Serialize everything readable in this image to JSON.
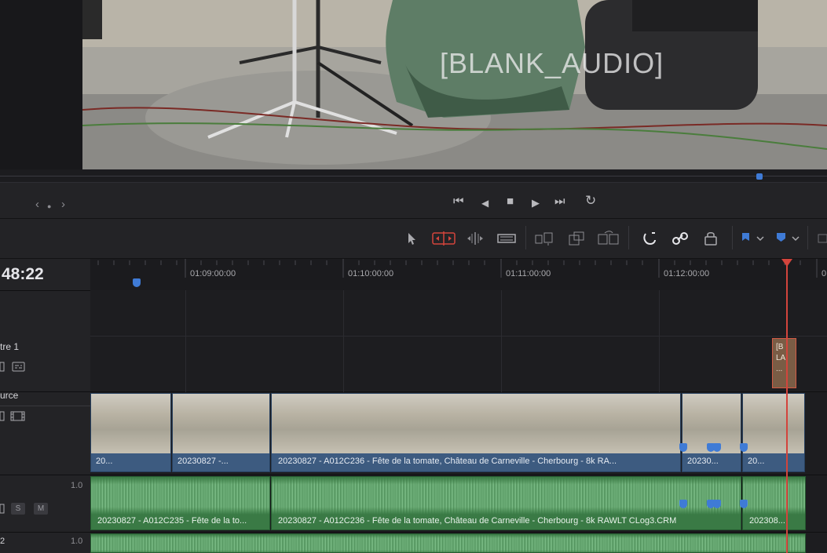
{
  "viewer": {
    "subtitle_overlay": "[BLANK_AUDIO]"
  },
  "transport": {
    "jog_left": "‹",
    "jog_dot": "●",
    "jog_right": "›",
    "first_frame": "⏮",
    "prev_frame": "◀",
    "stop": "■",
    "play": "▶",
    "last_frame": "⏭",
    "loop": "↻"
  },
  "timeline": {
    "timecode": "48:22",
    "ruler_labels": [
      "01:09:00:00",
      "01:10:00:00",
      "01:11:00:00",
      "01:12:00:00",
      "0"
    ],
    "tracks": {
      "subtitle_name": "tre 1",
      "video_name": "urce",
      "audio1_volume": "1.0",
      "audio1_solo": "S",
      "audio1_mute": "M",
      "audio2_name": "2",
      "audio2_volume": "1.0"
    },
    "subtitle_clip_text": "[B LA ...",
    "video_clips": [
      {
        "name": "20..."
      },
      {
        "name": "20230827 -..."
      },
      {
        "name": "20230827 - A012C236 - Fête de la tomate, Château de Carneville - Cherbourg - 8k RA..."
      },
      {
        "name": "20230..."
      },
      {
        "name": "20..."
      }
    ],
    "audio_clips": [
      {
        "name": "20230827 - A012C235 - Fête de la to..."
      },
      {
        "name": "20230827 - A012C236 - Fête de la tomate, Château de Carneville - Cherbourg - 8k RAWLT CLog3.CRM"
      },
      {
        "name": "202308..."
      }
    ]
  },
  "colors": {
    "playhead": "#d3443c",
    "marker": "#3f7bd6",
    "video_clip": "#3d5b80",
    "audio_clip": "#3a7a45",
    "active_tool": "#d3443c"
  }
}
